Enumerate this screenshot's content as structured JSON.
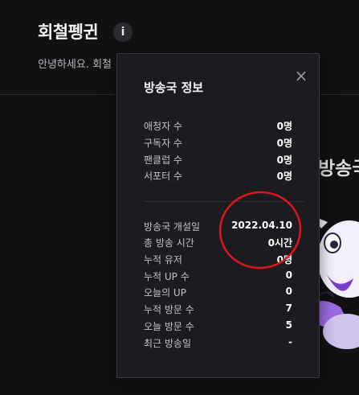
{
  "header": {
    "title": "회철펭귄",
    "info_label": "i",
    "greeting": "안녕하세요. 회철"
  },
  "background": {
    "headline": "방송국"
  },
  "popup": {
    "title": "방송국 정보",
    "close_label": "×",
    "stats_top": [
      {
        "label": "애청자 수",
        "value": "0명"
      },
      {
        "label": "구독자 수",
        "value": "0명"
      },
      {
        "label": "팬클럽 수",
        "value": "0명"
      },
      {
        "label": "서포터 수",
        "value": "0명"
      }
    ],
    "stats_bottom": [
      {
        "label": "방송국 개설일",
        "value": "2022.04.10"
      },
      {
        "label": "총 방송 시간",
        "value": "0시간"
      },
      {
        "label": "누적 유저",
        "value": "0명"
      },
      {
        "label": "누적 UP 수",
        "value": "0"
      },
      {
        "label": "오늘의 UP",
        "value": "0"
      },
      {
        "label": "누적 방문 수",
        "value": "7"
      },
      {
        "label": "오늘 방문 수",
        "value": "5"
      },
      {
        "label": "최근 방송일",
        "value": "-"
      }
    ]
  },
  "colors": {
    "annotation": "#e0151b",
    "background": "#111114",
    "popup_background": "#1c1c20"
  }
}
